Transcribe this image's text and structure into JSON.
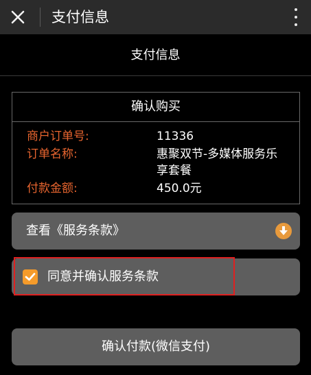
{
  "appbar": {
    "title": "支付信息",
    "close_icon": "close-icon",
    "more_icon": "more-vertical-icon"
  },
  "header": {
    "title": "支付信息"
  },
  "order": {
    "heading": "确认购买",
    "rows": [
      {
        "label": "商户订单号:",
        "value": "11336"
      },
      {
        "label": "订单名称:",
        "value": "惠聚双节-多媒体服务乐享套餐"
      },
      {
        "label": "付款金额:",
        "value": "450.0元"
      }
    ]
  },
  "terms": {
    "label": "查看《服务条款》",
    "icon": "arrow-down-circle-icon"
  },
  "agree": {
    "checked": true,
    "label": "同意并确认服务条款"
  },
  "confirm": {
    "label": "确认付款(微信支付)"
  },
  "colors": {
    "accent_orange": "#e8652f",
    "checkbox_orange": "#f59b2a",
    "highlight_red": "#e02020",
    "panel_gray": "#5e5e5e"
  }
}
